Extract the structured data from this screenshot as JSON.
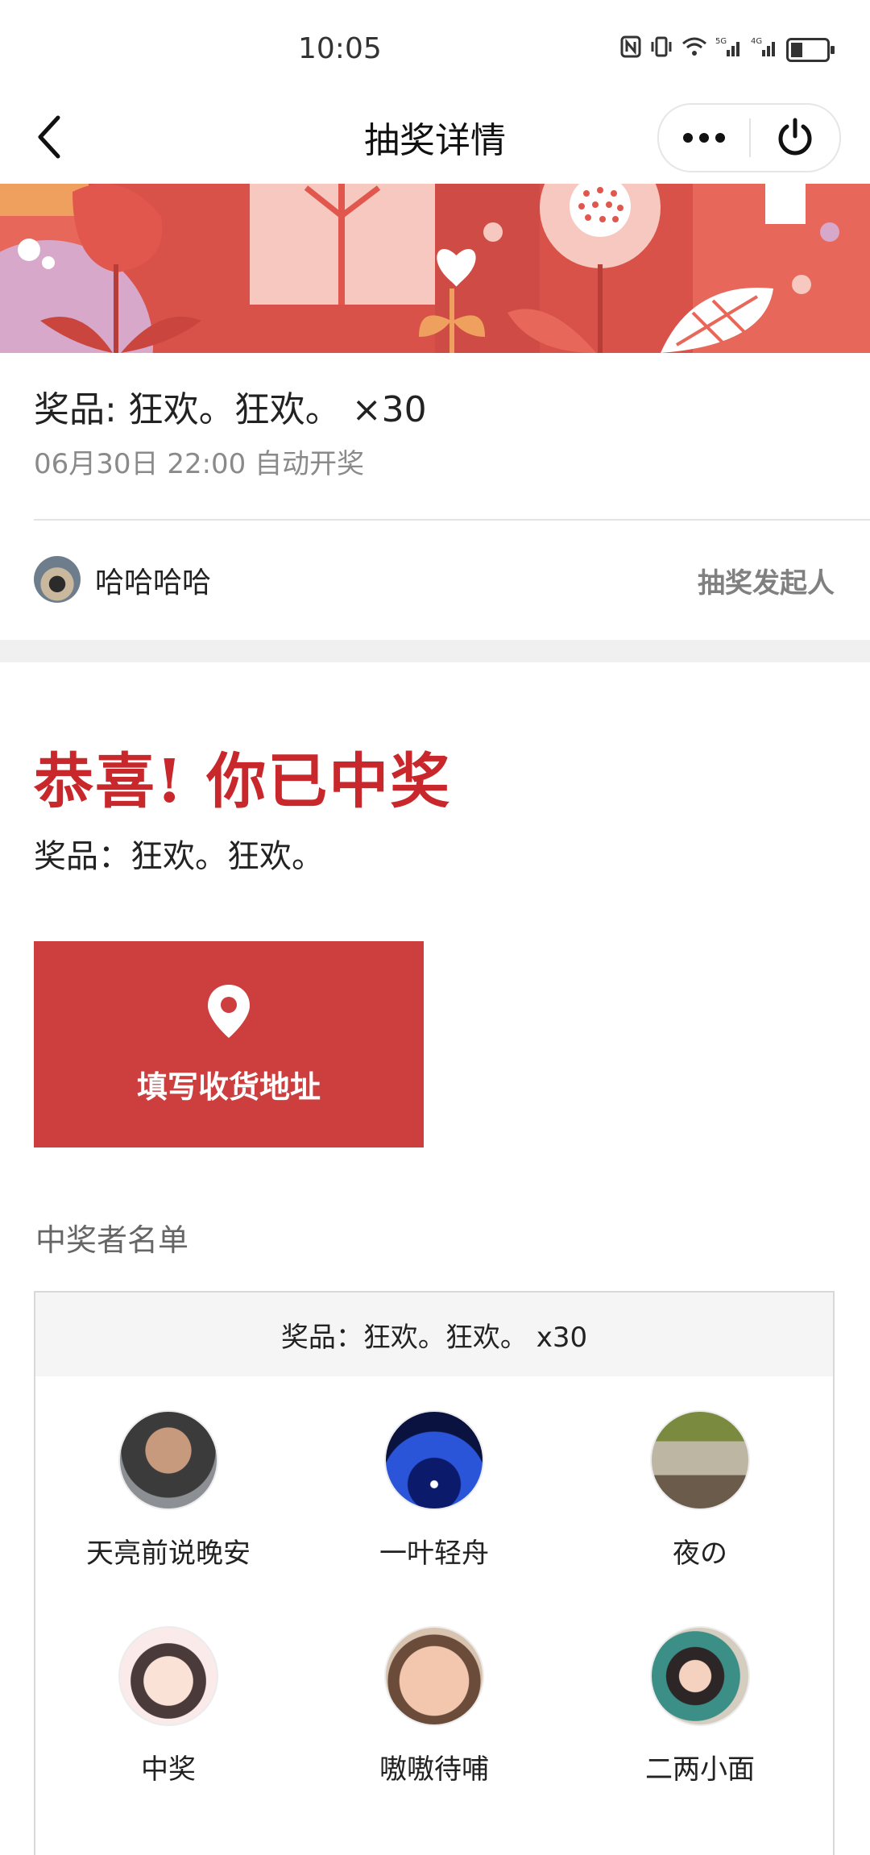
{
  "status_bar": {
    "time": "10:05",
    "icons": [
      "nfc-icon",
      "vibrate-icon",
      "wifi-icon",
      "signal-5g-icon",
      "signal-4g-icon",
      "battery-icon"
    ]
  },
  "nav": {
    "title": "抽奖详情",
    "back_icon": "back-chevron-icon",
    "more_icon": "more-dots-icon",
    "close_icon": "power-icon"
  },
  "prize": {
    "title": "奖品: 狂欢。狂欢。 ×30",
    "subtitle": "06月30日 22:00 自动开奖"
  },
  "initiator": {
    "name": "哈哈哈哈",
    "role": "抽奖发起人"
  },
  "result": {
    "title": "恭喜! 你已中奖",
    "prize_text": "奖品：狂欢。狂欢。",
    "address_button_label": "填写收货地址",
    "address_icon": "location-pin-icon"
  },
  "winners": {
    "heading": "中奖者名单",
    "box_header": "奖品：狂欢。狂欢。 x30",
    "list": [
      {
        "name": "天亮前说晚安",
        "avatar_color": "#5a5047"
      },
      {
        "name": "一叶轻舟",
        "avatar_color": "#1e3fb0"
      },
      {
        "name": "夜の",
        "avatar_color": "#a9a08c"
      },
      {
        "name": "中奖",
        "avatar_color": "#f3dede"
      },
      {
        "name": "嗷嗷待哺",
        "avatar_color": "#d9b9a0"
      },
      {
        "name": "二两小面",
        "avatar_color": "#c6b9a6"
      }
    ]
  },
  "colors": {
    "accent_red": "#c8282b",
    "button_red": "#cd3e3e",
    "banner_red": "#e7685a"
  }
}
